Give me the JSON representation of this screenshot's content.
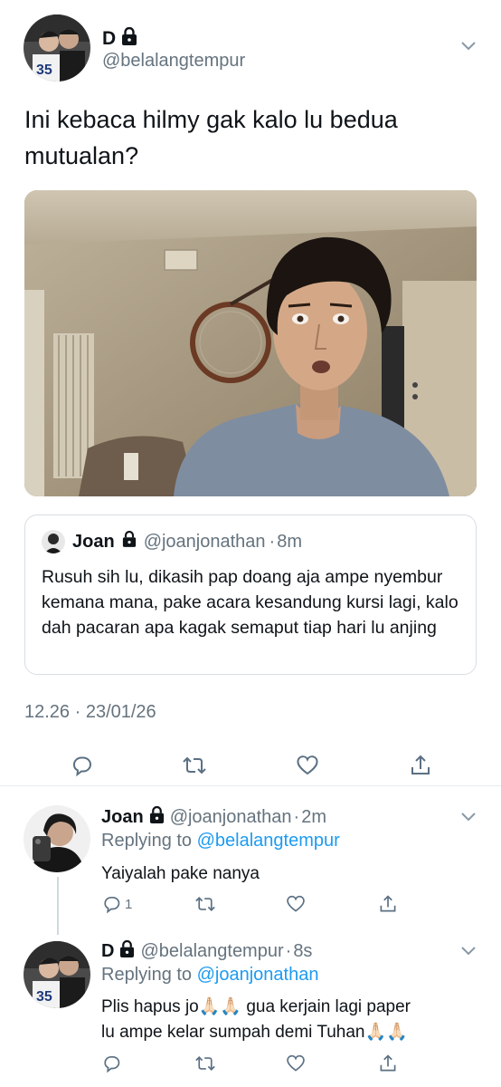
{
  "main_tweet": {
    "display_name": "D",
    "handle": "@belalangtempur",
    "text": "Ini kebaca hilmy gak kalo lu bedua mutualan?",
    "timestamp": "12.26 · 23/01/26",
    "quoted": {
      "display_name": "Joan",
      "handle": "@joanjonathan",
      "time": "8m",
      "text": "Rusuh sih lu, dikasih pap doang aja ampe nyembur kemana mana, pake acara kesandung kursi lagi, kalo dah pacaran apa kagak semaput tiap hari lu anjing"
    },
    "actions": [
      "reply-icon",
      "retweet-icon",
      "like-icon",
      "share-icon"
    ]
  },
  "replies": [
    {
      "display_name": "Joan",
      "handle": "@joanjonathan",
      "sep": "·",
      "time": "2m",
      "replying_prefix": "Replying to",
      "replying_to": "@belalangtempur",
      "text": "Yaiyalah pake nanya",
      "reply_count": "1"
    },
    {
      "display_name": "D",
      "handle": "@belalangtempur",
      "sep": "·",
      "time": "8s",
      "replying_prefix": "Replying to",
      "replying_to": "@joanjonathan",
      "text_line1": "Plis hapus jo🙏🏻🙏🏻 gua kerjain lagi paper",
      "text_line2": "lu ampe kelar sumpah demi Tuhan🙏🏻🙏🏻"
    }
  ],
  "colors": {
    "link": "#1d9bf0",
    "secondary_text": "#65737e",
    "primary_text": "#0f1419",
    "divider": "#e6ecf0"
  }
}
